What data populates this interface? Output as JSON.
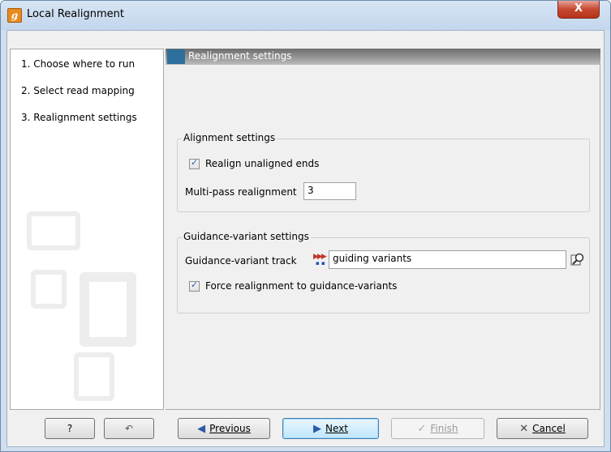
{
  "window": {
    "title": "Local Realignment",
    "app_icon_letter": "g",
    "close_label": "X"
  },
  "steps": [
    {
      "label": "1.  Choose where to run"
    },
    {
      "label": "2.  Select read mapping"
    },
    {
      "label": "3.  Realignment settings"
    }
  ],
  "section": {
    "title": "Realignment settings"
  },
  "alignment_group": {
    "title": "Alignment settings",
    "realign_ends": {
      "label": "Realign unaligned ends",
      "checked": true
    },
    "multipass": {
      "label": "Multi-pass realignment",
      "value": "3"
    }
  },
  "guidance_group": {
    "title": "Guidance-variant settings",
    "track": {
      "label": "Guidance-variant track",
      "value": "guiding variants",
      "icon": "variant-track-icon"
    },
    "force": {
      "label": "Force realignment to guidance-variants",
      "checked": true
    }
  },
  "buttons": {
    "help": "?",
    "previous": "Previous",
    "next": "Next",
    "finish": "Finish",
    "cancel": "Cancel"
  },
  "colors": {
    "accent": "#2e6f9e",
    "header_bar": "#8a8a8a",
    "close": "#c5482f"
  }
}
